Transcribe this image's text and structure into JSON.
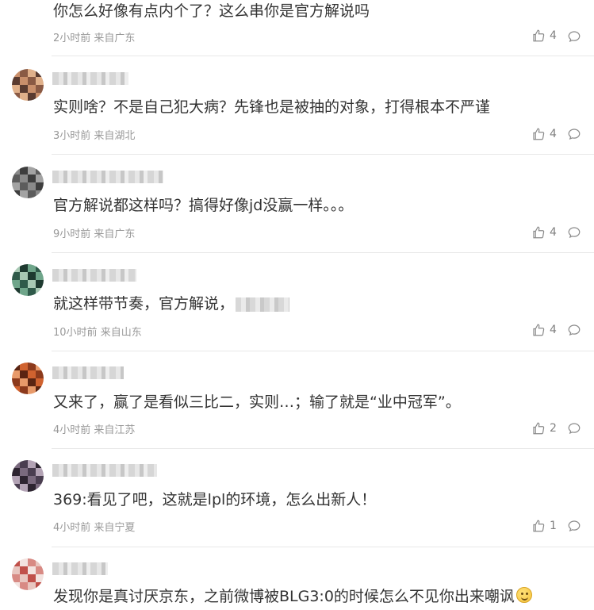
{
  "comments": [
    {
      "text": "你怎么好像有点内个了？这么串你是官方解说吗",
      "time": "2小时前",
      "location": "来自广东",
      "likes": "4",
      "avatar_colors": []
    },
    {
      "text": "实则啥？不是自己犯大病？先锋也是被抽的对象，打得根本不严谨",
      "time": "3小时前",
      "location": "来自湖北",
      "likes": "4",
      "avatar_colors": [
        "#c98f6b",
        "#8a5a44",
        "#e0b08a",
        "#5a3b30"
      ]
    },
    {
      "text": "官方解说都这样吗？搞得好像jd没赢一样。。。",
      "time": "9小时前",
      "location": "来自广东",
      "likes": "4",
      "avatar_colors": [
        "#5c5c5c",
        "#8a8a8a",
        "#3e3e3e",
        "#a3a3a3"
      ]
    },
    {
      "text": "就这样带节奏，官方解说，",
      "time": "10小时前",
      "location": "来自山东",
      "likes": "4",
      "avatar_colors": [
        "#6fa58a",
        "#2f5a4a",
        "#a8c9b4",
        "#1e3a30"
      ]
    },
    {
      "text": "又来了，赢了是看似三比二，实则…；输了就是“业中冠军”。",
      "time": "4小时前",
      "location": "来自江苏",
      "likes": "2",
      "avatar_colors": [
        "#d0622f",
        "#8c3a1c",
        "#e89a6a",
        "#5a2412"
      ]
    },
    {
      "text": "369:看见了吧，这就是lpl的环境，怎么出新人！",
      "time": "4小时前",
      "location": "来自宁夏",
      "likes": "1",
      "avatar_colors": [
        "#7a6a7e",
        "#4a3e50",
        "#b3a3b5",
        "#2d2430"
      ]
    },
    {
      "text": "发现你是真讨厌京东，之前微博被BLG3:0的时候怎么不见你出来嘲讽",
      "time": "",
      "location": "",
      "likes": "",
      "avatar_colors": [
        "#e8c6c0",
        "#c0504a",
        "#f3e3e0",
        "#d88a84"
      ]
    }
  ],
  "icons": {
    "like": "thumbs-up-icon",
    "reply": "comment-bubble-icon",
    "emoji": "smiley-emoji-icon"
  },
  "colors": {
    "text": "#333333",
    "meta": "#999999",
    "divider": "#e8e8e8"
  }
}
